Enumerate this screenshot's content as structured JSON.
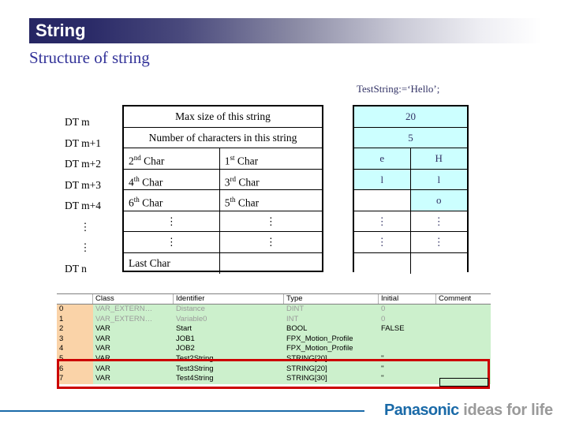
{
  "slide": {
    "title": "String",
    "subtitle": "Structure of string",
    "annotation": "TestString:=‘Hello’;"
  },
  "row_labels": [
    "DT m",
    "DT m+1",
    "DT m+2",
    "DT m+3",
    "DT m+4",
    "⋮",
    "⋮",
    "DT n"
  ],
  "structure_table": {
    "rows": [
      {
        "span": true,
        "text": "Max size of this string"
      },
      {
        "span": true,
        "text": "Number of characters in this string"
      },
      {
        "span": false,
        "left": "2nd Char",
        "left_base": "2",
        "left_sup": "nd",
        "left_tail": " Char",
        "right_base": "1",
        "right_sup": "st",
        "right_tail": " Char"
      },
      {
        "span": false,
        "left": "4th Char",
        "left_base": "4",
        "left_sup": "th",
        "left_tail": " Char",
        "right_base": "3",
        "right_sup": "rd",
        "right_tail": " Char"
      },
      {
        "span": false,
        "left": "6th Char",
        "left_base": "6",
        "left_sup": "th",
        "left_tail": " Char",
        "right_base": "5",
        "right_sup": "th",
        "right_tail": " Char"
      },
      {
        "span": false,
        "left_base": "⋮",
        "left_sup": "",
        "left_tail": "",
        "right_base": "⋮",
        "right_sup": "",
        "right_tail": "",
        "dots": true
      },
      {
        "span": false,
        "left_base": "⋮",
        "left_sup": "",
        "left_tail": "",
        "right_base": "⋮",
        "right_sup": "",
        "right_tail": "",
        "dots": true
      },
      {
        "span": false,
        "left_base": "Last Char",
        "left_sup": "",
        "left_tail": "",
        "right_base": "",
        "right_sup": "",
        "right_tail": ""
      }
    ]
  },
  "value_table": {
    "fill_color": "#ccffff",
    "text_color": "#333366",
    "rows": [
      {
        "span": true,
        "text": "20",
        "fill": true
      },
      {
        "span": true,
        "text": "5",
        "fill": true
      },
      {
        "span": false,
        "left": "e",
        "right": "H",
        "left_fill": true,
        "right_fill": true
      },
      {
        "span": false,
        "left": "l",
        "right": "l",
        "left_fill": true,
        "right_fill": true
      },
      {
        "span": false,
        "left": "",
        "right": "o",
        "left_fill": false,
        "right_fill": true
      },
      {
        "span": false,
        "left": "⋮",
        "right": "⋮",
        "left_fill": false,
        "right_fill": false
      },
      {
        "span": false,
        "left": "⋮",
        "right": "⋮",
        "left_fill": false,
        "right_fill": false
      },
      {
        "span": false,
        "left": "",
        "right": "",
        "left_fill": false,
        "right_fill": false
      }
    ]
  },
  "declaration_grid": {
    "headers": [
      "",
      "Class",
      "Identifier",
      "Type",
      "Initial",
      "Comment"
    ],
    "highlight_color": "#cc0000",
    "rows": [
      {
        "num": "0",
        "class": "VAR_EXTERN…",
        "identifier": "Distance",
        "type": "DINT",
        "initial": "0",
        "comment": "",
        "dim": true
      },
      {
        "num": "1",
        "class": "VAR_EXTERN…",
        "identifier": "Variable0",
        "type": "INT",
        "initial": "0",
        "comment": "",
        "dim": true
      },
      {
        "num": "2",
        "class": "VAR",
        "identifier": "Start",
        "type": "BOOL",
        "initial": "FALSE",
        "comment": "",
        "dim": false
      },
      {
        "num": "3",
        "class": "VAR",
        "identifier": "JOB1",
        "type": "FPX_Motion_Profile",
        "initial": "",
        "comment": "",
        "dim": false
      },
      {
        "num": "4",
        "class": "VAR",
        "identifier": "JOB2",
        "type": "FPX_Motion_Profile",
        "initial": "",
        "comment": "",
        "dim": false
      },
      {
        "num": "5",
        "class": "VAR",
        "identifier": "Test2String",
        "type": "STRING[20]",
        "initial": "''",
        "comment": "",
        "dim": false
      },
      {
        "num": "6",
        "class": "VAR",
        "identifier": "Test3String",
        "type": "STRING[20]",
        "initial": "''",
        "comment": "",
        "dim": false
      },
      {
        "num": "7",
        "class": "VAR",
        "identifier": "Test4String",
        "type": "STRING[30]",
        "initial": "''",
        "comment": "",
        "dim": false
      }
    ]
  },
  "footer": {
    "brand_primary": "Panasonic",
    "brand_tagline": "ideas for life",
    "brand_color": "#1a6aa8",
    "tagline_color": "#9a9a9a"
  }
}
